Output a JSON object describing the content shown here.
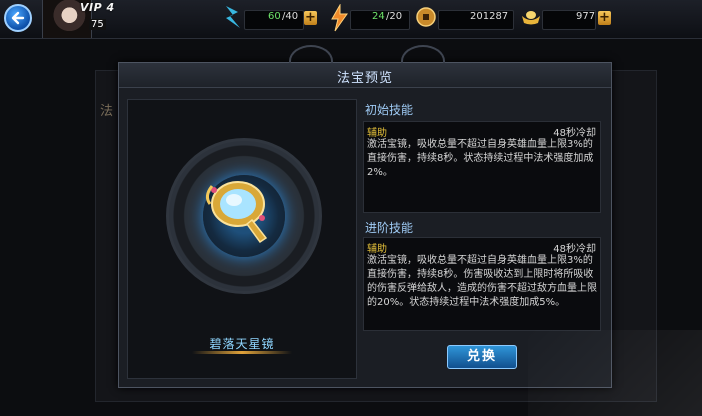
{
  "hud": {
    "vip_label": "VIP 4",
    "player_level": "75",
    "stamina": {
      "current": "60",
      "max": "/40"
    },
    "energy": {
      "current": "24",
      "max": "/20"
    },
    "coins": "201287",
    "gold": "977",
    "plus": "+"
  },
  "background": {
    "fragment": "法"
  },
  "dialog": {
    "title": "法宝预览",
    "item_name": "碧落天星镜",
    "initial_skill": {
      "heading": "初始技能",
      "type": "辅助",
      "cooldown": "48秒冷却",
      "description": "激活宝镜，吸收总量不超过自身英雄血量上限3%的直接伤害，持续8秒。状态持续过程中法术强度加成2%。"
    },
    "advanced_skill": {
      "heading": "进阶技能",
      "type": "辅助",
      "cooldown": "48秒冷却",
      "description": "激活宝镜，吸收总量不超过自身英雄血量上限3%的直接伤害，持续8秒。伤害吸收达到上限时将所吸收的伤害反弹给敌人，造成的伤害不超过敌方血量上限的20%。状态持续过程中法术强度加成5%。"
    },
    "exchange_button": "兑换"
  },
  "colors": {
    "accent_blue": "#2f95d8",
    "skill_type_gold": "#e6c23a",
    "resource_green": "#6ee36a"
  }
}
